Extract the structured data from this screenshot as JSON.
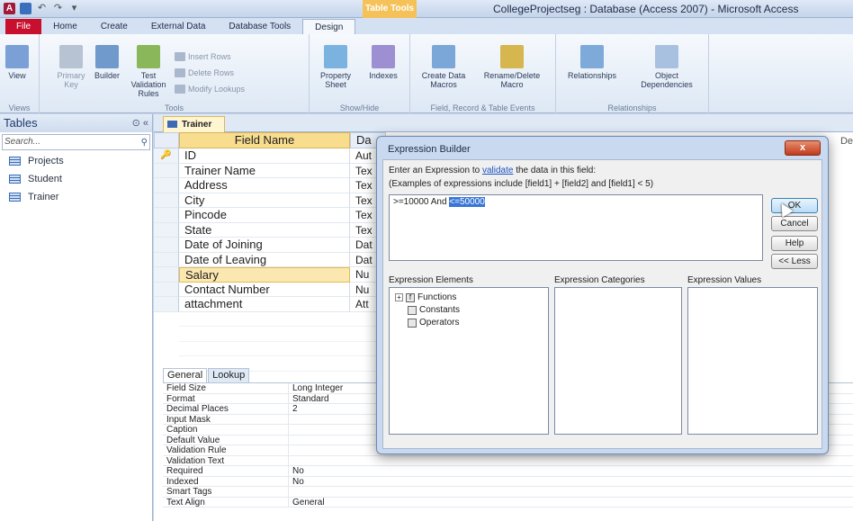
{
  "window": {
    "title": "CollegeProjectseg : Database (Access 2007)  -  Microsoft Access",
    "context_tab_group": "Table Tools",
    "app_logo": "A"
  },
  "ribbon_tabs": [
    "File",
    "Home",
    "Create",
    "External Data",
    "Database Tools",
    "Design"
  ],
  "ribbon": {
    "views": {
      "label": "Views",
      "view_button": "View"
    },
    "tools": {
      "label": "Tools",
      "primary_key": "Primary Key",
      "builder": "Builder",
      "test_validation_rules": "Test Validation Rules",
      "insert_rows": "Insert Rows",
      "delete_rows": "Delete Rows",
      "modify_lookups": "Modify Lookups"
    },
    "show_hide": {
      "label": "Show/Hide",
      "property_sheet": "Property Sheet",
      "indexes": "Indexes"
    },
    "field_record_events": {
      "label": "Field, Record & Table Events",
      "create_data_macros": "Create Data Macros",
      "rename_delete_macro": "Rename/Delete Macro"
    },
    "relationships_group": {
      "label": "Relationships",
      "relationships": "Relationships",
      "object_dependencies": "Object Dependencies"
    }
  },
  "nav": {
    "header": "Tables",
    "header_controls": "⊙ «",
    "search_placeholder": "Search...",
    "items": [
      "Projects",
      "Student",
      "Trainer"
    ]
  },
  "document": {
    "tab_label": "Trainer",
    "col_field_name": "Field Name",
    "col_data_type": "Da",
    "fields": [
      {
        "name": "ID",
        "type": "Aut",
        "key": true
      },
      {
        "name": "Trainer Name",
        "type": "Tex"
      },
      {
        "name": "Address",
        "type": "Tex"
      },
      {
        "name": "City",
        "type": "Tex"
      },
      {
        "name": "Pincode",
        "type": "Tex"
      },
      {
        "name": "State",
        "type": "Tex"
      },
      {
        "name": "Date of Joining",
        "type": "Dat"
      },
      {
        "name": "Date of Leaving",
        "type": "Dat"
      },
      {
        "name": "Salary",
        "type": "Nu"
      },
      {
        "name": "Contact Number",
        "type": "Nu"
      },
      {
        "name": "attachment",
        "type": "Att"
      }
    ],
    "description_partial": "De"
  },
  "properties": {
    "tabs": [
      "General",
      "Lookup"
    ],
    "rows": [
      {
        "label": "Field Size",
        "value": "Long Integer"
      },
      {
        "label": "Format",
        "value": "Standard"
      },
      {
        "label": "Decimal Places",
        "value": "2"
      },
      {
        "label": "Input Mask",
        "value": ""
      },
      {
        "label": "Caption",
        "value": ""
      },
      {
        "label": "Default Value",
        "value": ""
      },
      {
        "label": "Validation Rule",
        "value": ""
      },
      {
        "label": "Validation Text",
        "value": ""
      },
      {
        "label": "Required",
        "value": "No"
      },
      {
        "label": "Indexed",
        "value": "No"
      },
      {
        "label": "Smart Tags",
        "value": ""
      },
      {
        "label": "Text Align",
        "value": "General"
      }
    ]
  },
  "dialog": {
    "title": "Expression Builder",
    "close": "x",
    "instruction_prefix": "Enter an Expression to ",
    "instruction_link": "validate",
    "instruction_suffix": " the data in this field:",
    "examples": "(Examples of expressions include [field1] + [field2] and [field1] < 5)",
    "expression_plain": ">=10000 And ",
    "expression_selected": "<=50000",
    "buttons": {
      "ok": "OK",
      "cancel": "Cancel",
      "help": "Help",
      "less": "<< Less"
    },
    "elements_label": "Expression Elements",
    "categories_label": "Expression Categories",
    "values_label": "Expression Values",
    "elements": [
      "Functions",
      "Constants",
      "Operators"
    ]
  }
}
